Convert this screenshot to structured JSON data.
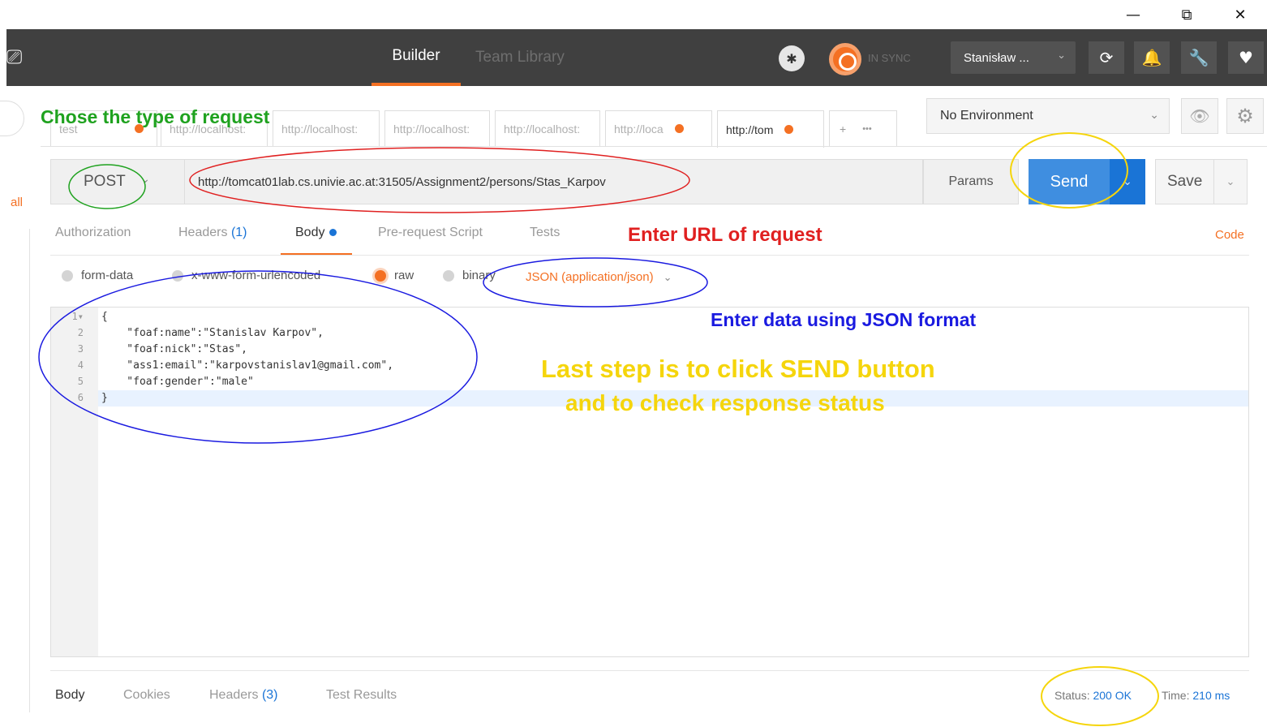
{
  "window_controls": {
    "minimize": "—",
    "restore": "⧉",
    "close": "✕"
  },
  "topbar": {
    "new_window_icon": "new-window-icon",
    "nav_builder": "Builder",
    "nav_team_library": "Team Library",
    "sync_label": "IN SYNC",
    "user_name": "Stanisław ...",
    "accent_color": "#f47023"
  },
  "tabs": [
    {
      "label": "test",
      "dot": true
    },
    {
      "label": "http://localhost:",
      "dot": false
    },
    {
      "label": "http://localhost:",
      "dot": false
    },
    {
      "label": "http://localhost:",
      "dot": false
    },
    {
      "label": "http://localhost:",
      "dot": false
    },
    {
      "label": "http://loca",
      "dot": true
    },
    {
      "label": "http://tom",
      "dot": true
    }
  ],
  "tab_add": "+",
  "tab_more": "•••",
  "sidebar": {
    "all_label": "all"
  },
  "environment": {
    "selected": "No Environment"
  },
  "request": {
    "method": "POST",
    "url": "http://tomcat01lab.cs.univie.ac.at:31505/Assignment2/persons/Stas_Karpov",
    "params_label": "Params",
    "send_label": "Send",
    "save_label": "Save"
  },
  "subtabs": {
    "authorization": "Authorization",
    "headers": "Headers",
    "headers_count": "(1)",
    "body": "Body",
    "pre_request": "Pre-request Script",
    "tests": "Tests",
    "code": "Code"
  },
  "body_types": {
    "form_data": "form-data",
    "urlencoded": "x-www-form-urlencoded",
    "raw": "raw",
    "binary": "binary",
    "selected": "raw",
    "format": "JSON (application/json)"
  },
  "editor": {
    "lines": [
      {
        "num": "1",
        "text": "{"
      },
      {
        "num": "2",
        "text": "    \"foaf:name\":\"Stanislav Karpov\","
      },
      {
        "num": "3",
        "text": "    \"foaf:nick\":\"Stas\","
      },
      {
        "num": "4",
        "text": "    \"ass1:email\":\"karpovstanislav1@gmail.com\","
      },
      {
        "num": "5",
        "text": "    \"foaf:gender\":\"male\""
      },
      {
        "num": "6",
        "text": "}"
      }
    ]
  },
  "response": {
    "body": "Body",
    "cookies": "Cookies",
    "headers": "Headers",
    "headers_count": "(3)",
    "test_results": "Test Results",
    "status_label": "Status:",
    "status_value": "200 OK",
    "time_label": "Time:",
    "time_value": "210 ms"
  },
  "annotations": {
    "choose_type": "Chose the type of request",
    "enter_url": "Enter URL of request",
    "enter_json": "Enter data using JSON format",
    "last_step_1": "Last step is to click SEND button",
    "last_step_2": "and to check response status"
  }
}
